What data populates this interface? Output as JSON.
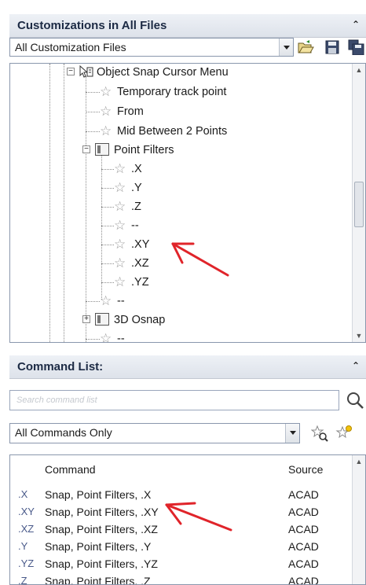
{
  "customizations_panel": {
    "title": "Customizations in All Files",
    "file_filter": "All Customization Files"
  },
  "tree": {
    "items": [
      {
        "label": "Object Snap Cursor Menu",
        "kind": "menu"
      },
      {
        "label": "Temporary track point",
        "kind": "command"
      },
      {
        "label": "From",
        "kind": "command"
      },
      {
        "label": "Mid Between 2 Points",
        "kind": "command"
      },
      {
        "label": "Point Filters",
        "kind": "submenu"
      },
      {
        "label": ".X",
        "kind": "command"
      },
      {
        "label": ".Y",
        "kind": "command"
      },
      {
        "label": ".Z",
        "kind": "command"
      },
      {
        "label": "--",
        "kind": "separator"
      },
      {
        "label": ".XY",
        "kind": "command"
      },
      {
        "label": ".XZ",
        "kind": "command"
      },
      {
        "label": ".YZ",
        "kind": "command"
      },
      {
        "label": "--",
        "kind": "separator"
      },
      {
        "label": "3D Osnap",
        "kind": "submenu"
      },
      {
        "label": "--",
        "kind": "separator"
      }
    ]
  },
  "command_list_panel": {
    "title": "Command List:",
    "search_placeholder": "Search command list",
    "filter": "All Commands Only",
    "columns": {
      "command": "Command",
      "source": "Source"
    },
    "rows": [
      {
        "prefix": ".X",
        "command": "Snap, Point Filters, .X",
        "source": "ACAD"
      },
      {
        "prefix": ".XY",
        "command": "Snap, Point Filters, .XY",
        "source": "ACAD"
      },
      {
        "prefix": ".XZ",
        "command": "Snap, Point Filters, .XZ",
        "source": "ACAD"
      },
      {
        "prefix": ".Y",
        "command": "Snap, Point Filters, .Y",
        "source": "ACAD"
      },
      {
        "prefix": ".YZ",
        "command": "Snap, Point Filters, .YZ",
        "source": "ACAD"
      },
      {
        "prefix": ".Z",
        "command": "Snap, Point Filters, .Z",
        "source": "ACAD"
      }
    ]
  },
  "colors": {
    "annotation_arrow": "#e0242a",
    "header_text": "#1c2a44"
  }
}
